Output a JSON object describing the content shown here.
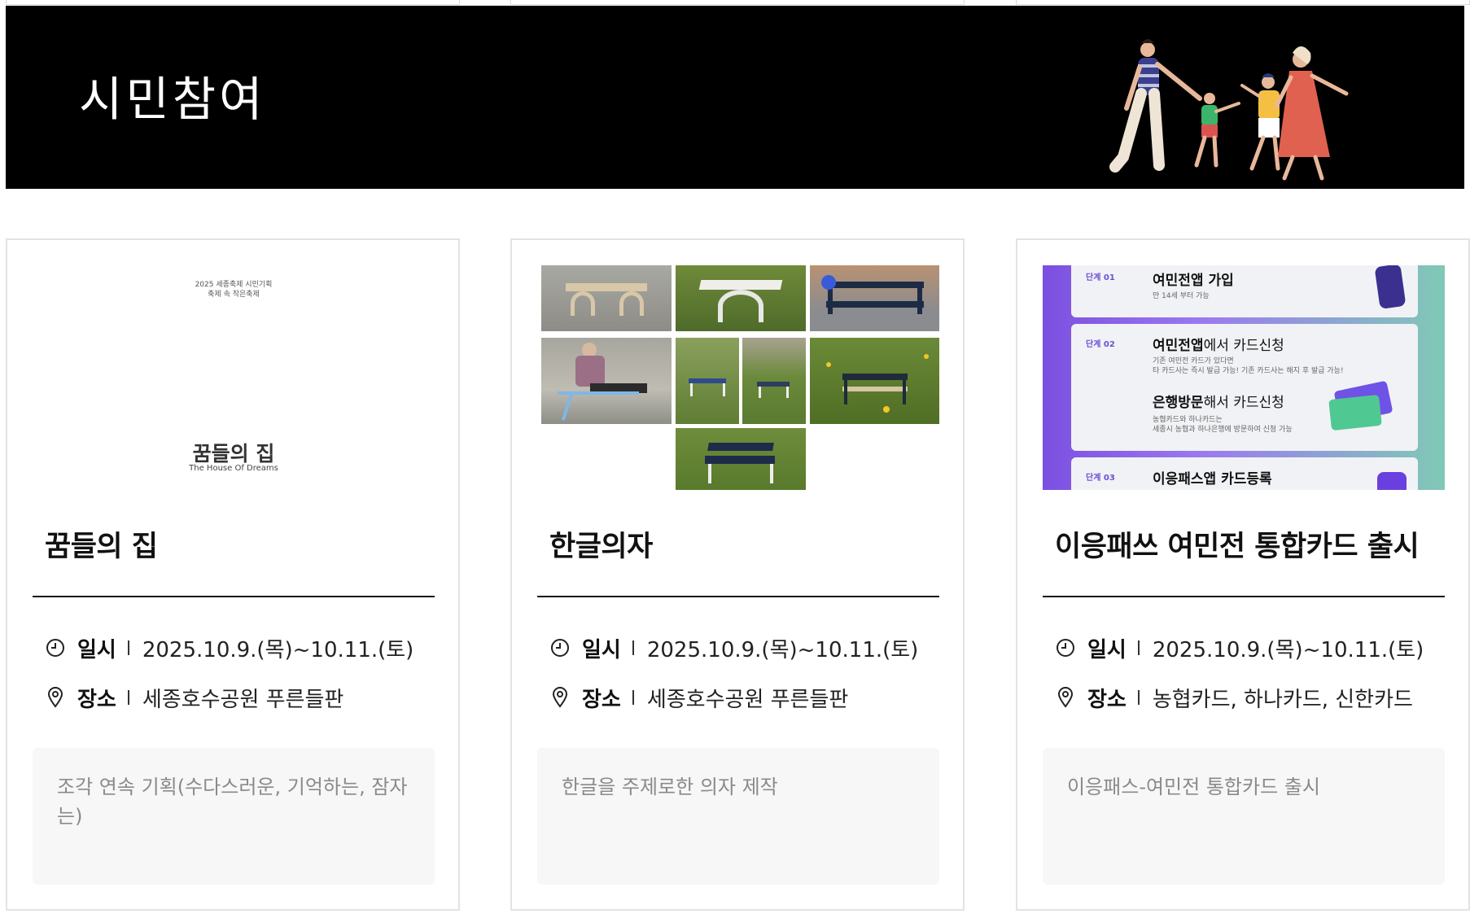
{
  "banner": {
    "title": "시민참여",
    "illustration": "family-walking-illustration"
  },
  "cards": [
    {
      "title": "꿈들의 집",
      "thumbnail": {
        "type": "poster",
        "line1": "2025 세종축제 시민기획",
        "line2": "축제 속 작은축제",
        "title_ko": "꿈들의 집",
        "title_en": "The House Of Dreams"
      },
      "date_label": "일시",
      "date_value": "2025.10.9.(목)~10.11.(토)",
      "place_label": "장소",
      "place_value": "세종호수공원 푸른들판",
      "description": "조각 연속 기획(수다스러운, 기억하는, 잠자는)"
    },
    {
      "title": "한글의자",
      "thumbnail": {
        "type": "photo-grid",
        "alt": "benches"
      },
      "date_label": "일시",
      "date_value": "2025.10.9.(목)~10.11.(토)",
      "place_label": "장소",
      "place_value": "세종호수공원 푸른들판",
      "description": "한글을 주제로한 의자 제작"
    },
    {
      "title": "이응패쓰 여민전 통합카드 출시",
      "thumbnail": {
        "type": "app-steps",
        "steps": [
          {
            "no": "단계 01",
            "heading_bold": "여민전앱 가입",
            "heading_rest": "",
            "sub": "만 14세 부터 가능"
          },
          {
            "no": "단계 02",
            "heading_bold": "여민전앱",
            "heading_rest": "에서 카드신청",
            "sub": "기존 여민전 카드가 있다면",
            "sub2": "타 카드사는 즉시 발급 가능! 기존 카드사는 해지 후 발급 가능!",
            "heading2_bold": "은행방문",
            "heading2_rest": "해서 카드신청",
            "sub3": "농협카드와 하나카드는",
            "sub4": "세종시 농협과 하나은행에 방문하여 신청 가능"
          },
          {
            "no": "단계 03",
            "heading_bold": "이응패스앱 카드등록",
            "heading_rest": ""
          }
        ]
      },
      "date_label": "일시",
      "date_value": "2025.10.9.(목)~10.11.(토)",
      "place_label": "장소",
      "place_value": "농협카드, 하나카드, 신한카드",
      "description": "이응패스-여민전 통합카드 출시"
    }
  ]
}
